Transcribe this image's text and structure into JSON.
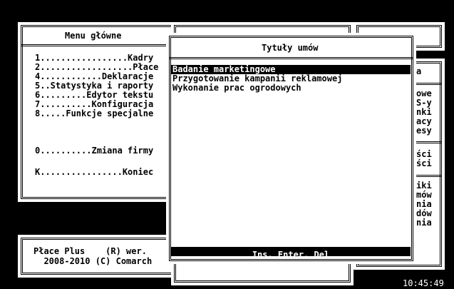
{
  "main_menu": {
    "title": "Menu główne",
    "items": [
      "1.................Kadry",
      "2..................Płace",
      "4............Deklaracje",
      "5..Statystyka i raporty",
      "6.........Edytor tekstu",
      "7..........Konfiguracja",
      "8.....Funkcje specjalne"
    ],
    "change_company": "0..........Zmiana firmy",
    "exit": "K................Koniec"
  },
  "footer": {
    "line1": "Płace Plus    (R) wer.",
    "line2": "  2008-2010 (C) Comarch"
  },
  "dialog": {
    "title": "Tytuły umów",
    "items": [
      "Badanie marketingowe",
      "Przygotowanie kampanii reklamowej",
      "Wykonanie prac ogrodowych"
    ],
    "selected_index": 0,
    "status": "Ins, Enter, Del"
  },
  "right_panel": {
    "group1": [
      "a"
    ],
    "group2": [
      "owe",
      "S-y",
      "nki",
      "acy",
      "esy"
    ],
    "group3": [
      "ści",
      "ści"
    ],
    "group4": [
      "iki",
      "mów",
      "nia",
      "dów",
      "nia"
    ]
  },
  "clock": "10:45:49"
}
